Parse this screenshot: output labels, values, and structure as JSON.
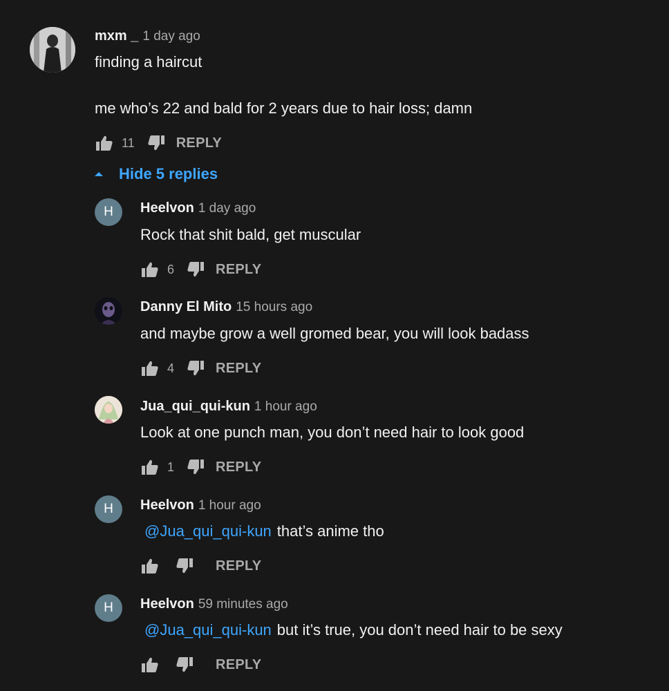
{
  "main_comment": {
    "author": "mxm _",
    "time": "1 day ago",
    "line1": "finding a haircut",
    "line2": "me who’s 22 and bald for 2 years due to hair loss; damn",
    "likes": "11",
    "reply_label": "REPLY"
  },
  "replies_toggle": {
    "label": "Hide 5 replies"
  },
  "replies": [
    {
      "author": "Heelvon",
      "time": "1 day ago",
      "avatar_letter": "H",
      "mention": "",
      "text": "Rock that shit bald, get muscular",
      "likes": "6",
      "reply_label": "REPLY"
    },
    {
      "author": "Danny El Mito",
      "time": "15 hours ago",
      "avatar_letter": "",
      "mention": "",
      "text": "and maybe grow a well gromed bear, you will look badass",
      "likes": "4",
      "reply_label": "REPLY"
    },
    {
      "author": "Jua_qui_qui-kun",
      "time": "1 hour ago",
      "avatar_letter": "",
      "mention": "",
      "text": "Look at one punch man, you don’t need hair to look good",
      "likes": "1",
      "reply_label": "REPLY"
    },
    {
      "author": "Heelvon",
      "time": "1 hour ago",
      "avatar_letter": "H",
      "mention": "@Jua_qui_qui-kun",
      "text": "that’s anime tho",
      "likes": "",
      "reply_label": "REPLY"
    },
    {
      "author": "Heelvon",
      "time": "59 minutes ago",
      "avatar_letter": "H",
      "mention": "@Jua_qui_qui-kun",
      "text": "but it’s true, you don’t need hair to be sexy",
      "likes": "",
      "reply_label": "REPLY"
    }
  ],
  "colors": {
    "background": "#181818",
    "link": "#3ea6ff",
    "secondary_text": "#aaaaaa",
    "letter_avatar": "#607d8b"
  },
  "icons": {
    "like": "thumbs-up-icon",
    "dislike": "thumbs-down-icon",
    "toggle": "caret-up-icon"
  }
}
